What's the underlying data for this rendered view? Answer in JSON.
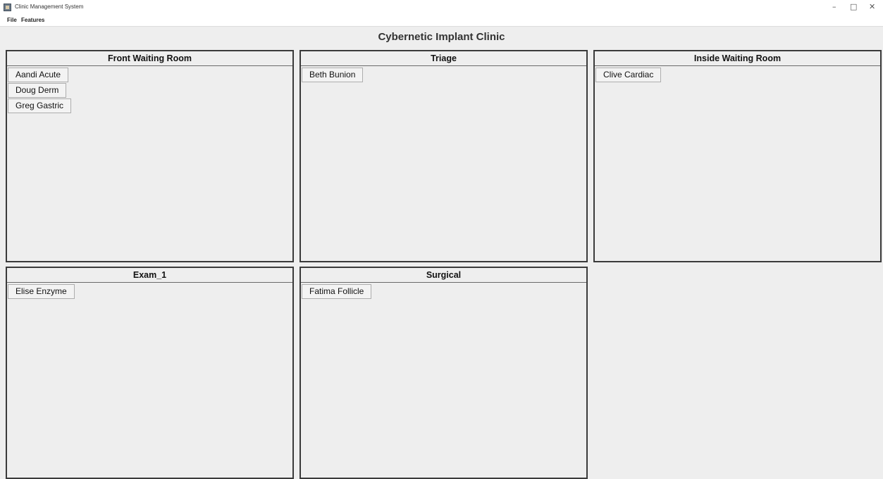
{
  "window": {
    "title": "Clinic Management System",
    "controls": {
      "minimize": "–",
      "maximize": "□",
      "close": "✕"
    }
  },
  "menu": [
    "File",
    "Features"
  ],
  "clinic_name": "Cybernetic Implant Clinic",
  "rooms": [
    {
      "name": "Front Waiting Room",
      "patients": [
        "Aandi Acute",
        "Doug Derm",
        "Greg Gastric"
      ]
    },
    {
      "name": "Triage",
      "patients": [
        "Beth Bunion"
      ]
    },
    {
      "name": "Inside Waiting Room",
      "patients": [
        "Clive Cardiac"
      ]
    },
    {
      "name": "Exam_1",
      "patients": [
        "Elise Enzyme"
      ]
    },
    {
      "name": "Surgical",
      "patients": [
        "Fatima Follicle"
      ]
    }
  ]
}
